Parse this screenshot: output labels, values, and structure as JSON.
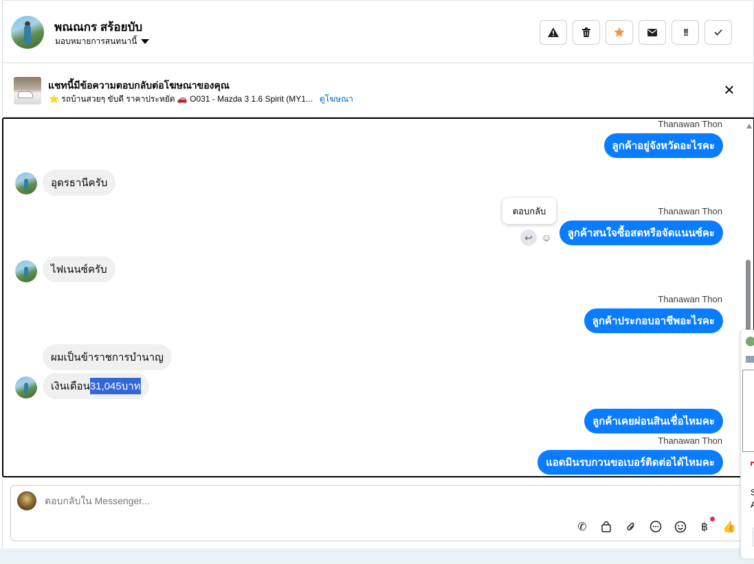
{
  "header": {
    "contact_name": "พณณกร สร้อยบับ",
    "assign_label": "มอบหมายการสนทนานี้",
    "tools": [
      {
        "name": "spam-button",
        "icon": "warning-icon"
      },
      {
        "name": "delete-button",
        "icon": "trash-icon"
      },
      {
        "name": "star-button",
        "icon": "star-icon"
      },
      {
        "name": "mark-unread-button",
        "icon": "envelope-icon"
      },
      {
        "name": "follow-up-button",
        "icon": "double-exclamation-icon"
      },
      {
        "name": "mark-done-button",
        "icon": "check-icon"
      }
    ],
    "star_color": "#f7923a"
  },
  "ad": {
    "title": "แชทนี้มีข้อความตอบกลับต่อโฆษณาของคุณ",
    "subtitle": "⭐ รถบ้านสวยๆ ขับดี ราคาประหยัด 🚗 O031 - Mazda 3 1.6 Spirit (MY1...",
    "link": "ดูโฆษณา"
  },
  "conversation": {
    "agent_name": "Thanawan Thon",
    "tooltip": "ตอบกลับ",
    "messages": [
      {
        "from": "agent",
        "text": "ลูกค้าอยู่จังหวัดอะไรคะ"
      },
      {
        "from": "customer",
        "text": "อุดรธานีครับ"
      },
      {
        "from": "agent",
        "text": "ลูกค้าสนใจซื้อสดหรือจัดแนนซ์คะ"
      },
      {
        "from": "customer",
        "text": "ไฟเนนซ์ครับ"
      },
      {
        "from": "agent",
        "text": "ลูกค้าประกอบอาชีพอะไรคะ"
      },
      {
        "from": "customer",
        "text": "ผมเป็นข้าราชการบำนาญ"
      },
      {
        "from": "customer",
        "text_prefix": "เงินเดือน ",
        "text_highlight": "31,045บาท"
      },
      {
        "from": "agent",
        "text": "ลูกค้าเคยผ่อนสินเชื่อไหมคะ"
      },
      {
        "from": "agent",
        "text": "แอดมินรบกวนขอเบอร์ติดต่อได้ไหมคะ"
      }
    ],
    "bubble_color": "#0a7cff"
  },
  "composer": {
    "placeholder": "ตอบกลับใน Messenger...",
    "icons": [
      "call-add-icon",
      "shopping-bag-icon",
      "attachment-icon",
      "saved-reply-icon",
      "emoji-icon",
      "baht-payment-icon",
      "thumbs-up-icon"
    ],
    "icon_glyphs": {
      "call": "✆",
      "bag": "👜",
      "attach": "🖇",
      "chat": "💬",
      "emoji": "☺",
      "baht": "฿",
      "like": "👍"
    }
  },
  "side_panel": {
    "letters": "S\nA"
  }
}
